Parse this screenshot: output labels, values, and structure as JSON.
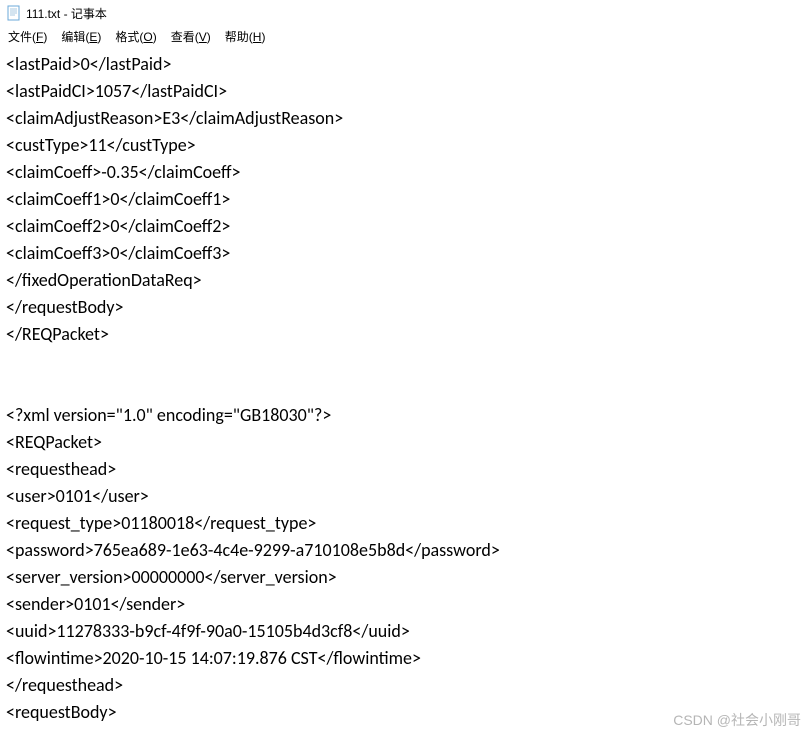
{
  "title_bar": {
    "filename": "111.txt",
    "app_name": "记事本",
    "full_title": "111.txt - 记事本"
  },
  "menu": {
    "file": {
      "label": "文件",
      "key": "F"
    },
    "edit": {
      "label": "编辑",
      "key": "E"
    },
    "format": {
      "label": "格式",
      "key": "O"
    },
    "view": {
      "label": "查看",
      "key": "V"
    },
    "help": {
      "label": "帮助",
      "key": "H"
    }
  },
  "content_lines": [
    "<lastPaid>0</lastPaid>",
    "<lastPaidCI>1057</lastPaidCI>",
    "<claimAdjustReason>E3</claimAdjustReason>",
    "<custType>11</custType>",
    "<claimCoeff>-0.35</claimCoeff>",
    "<claimCoeff1>0</claimCoeff1>",
    "<claimCoeff2>0</claimCoeff2>",
    "<claimCoeff3>0</claimCoeff3>",
    "</fixedOperationDataReq>",
    "</requestBody>",
    "</REQPacket>",
    "",
    "",
    "<?xml version=\"1.0\" encoding=\"GB18030\"?>",
    "<REQPacket>",
    "<requesthead>",
    "<user>0101</user>",
    "<request_type>01180018</request_type>",
    "<password>765ea689-1e63-4c4e-9299-a710108e5b8d</password>",
    "<server_version>00000000</server_version>",
    "<sender>0101</sender>",
    "<uuid>11278333-b9cf-4f9f-90a0-15105b4d3cf8</uuid>",
    "<flowintime>2020-10-15 14:07:19.876 CST</flowintime>",
    "</requesthead>",
    "<requestBody>"
  ],
  "watermark": "CSDN @社会小刚哥"
}
